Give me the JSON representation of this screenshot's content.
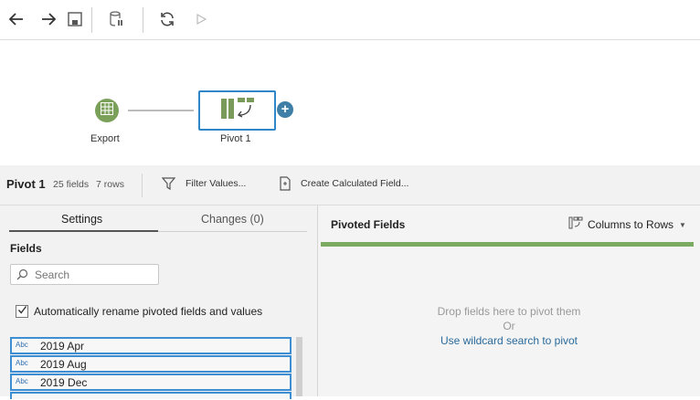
{
  "toolbar": {
    "buttons": [
      "back-arrow-icon",
      "forward-arrow-icon",
      "save-icon",
      "data-source-icon",
      "refresh-icon",
      "run-icon"
    ]
  },
  "flow": {
    "nodes": [
      {
        "label": "Export",
        "icon": "table-grid-icon",
        "color": "#7aa05a"
      },
      {
        "label": "Pivot 1",
        "icon": "pivot-icon",
        "color": "#7a9a5a"
      }
    ]
  },
  "header": {
    "step_name": "Pivot 1",
    "fields_count": "25 fields",
    "rows_count": "7 rows",
    "filter_label": "Filter Values...",
    "calc_label": "Create Calculated Field..."
  },
  "left_panel": {
    "tabs": [
      {
        "label": "Settings",
        "active": true
      },
      {
        "label": "Changes (0)",
        "active": false
      }
    ],
    "fields_title": "Fields",
    "search_placeholder": "Search",
    "auto_rename_label": "Automatically rename pivoted fields and values",
    "auto_rename_checked": true,
    "fields": [
      {
        "type": "Abc",
        "name": "2019 Apr"
      },
      {
        "type": "Abc",
        "name": "2019 Aug"
      },
      {
        "type": "Abc",
        "name": "2019 Dec"
      }
    ]
  },
  "right_panel": {
    "title": "Pivoted Fields",
    "mode_label": "Columns to Rows",
    "drop_hint": "Drop fields here to pivot them",
    "or_text": "Or",
    "wildcard_link": "Use wildcard search to pivot"
  },
  "colors": {
    "accent_blue": "#2f86c8",
    "node_green": "#7aa05a",
    "bar_green": "#7bab60"
  }
}
